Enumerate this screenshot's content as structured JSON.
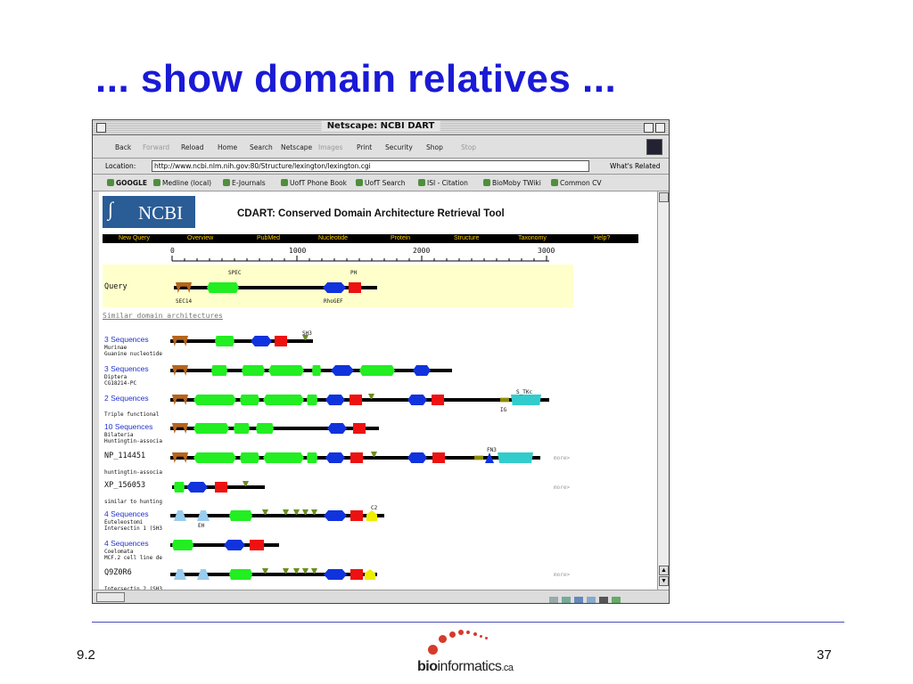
{
  "slide": {
    "title": "... show domain relatives ...",
    "left_number": "9.2",
    "right_number": "37",
    "logo_bold": "bio",
    "logo_rest": "informatics",
    "logo_suffix": ".ca"
  },
  "browser": {
    "window_title": "Netscape: NCBI DART",
    "nav_buttons": [
      "Back",
      "Forward",
      "Reload",
      "Home",
      "Search",
      "Netscape",
      "Images",
      "Print",
      "Security",
      "Shop",
      "Stop"
    ],
    "location_label": "Location:",
    "url": "http://www.ncbi.nlm.nih.gov:80/Structure/lexington/lexington.cgi",
    "whats_related": "What's Related",
    "bookmarks": [
      "GOOGLE",
      "Medline (local)",
      "E-Journals",
      "UofT Phone Book",
      "UofT Search",
      "ISI - Citation",
      "BioMoby TWiki",
      "Common CV"
    ]
  },
  "page": {
    "ncbi": "NCBI",
    "title": "CDART: Conserved Domain Architecture Retrieval Tool",
    "menu": [
      "New Query",
      "Overview",
      "PubMed",
      "Nucleotide",
      "Protein",
      "Structure",
      "Taxonomy",
      "Help?"
    ],
    "ruler": [
      "0",
      "1000",
      "2000",
      "3000"
    ],
    "query": {
      "label": "Query",
      "domain_labels": [
        "SPEC",
        "PH",
        "SEC14",
        "RhoGEF"
      ]
    },
    "section_title": "Similar domain architectures",
    "more_label": "more>",
    "rows": [
      {
        "name": "3 Sequences",
        "sub": "Murinae",
        "sub2": "Guanine nucleotide",
        "top_label": "SH3"
      },
      {
        "name": "3 Sequences",
        "sub": "Diptera",
        "sub2": "CG18214-PC"
      },
      {
        "name": "2 Sequences",
        "sub": "",
        "sub2": "Triple functional",
        "top_label": "S_TKc",
        "bottom_label": "IG"
      },
      {
        "name": "10 Sequences",
        "sub": "Bilateria",
        "sub2": "Huntingtin-associa"
      },
      {
        "name": "NP_114451",
        "sub": "",
        "sub2": "huntingtin-associa",
        "top_label": "FN3"
      },
      {
        "name": "XP_156053",
        "sub": "",
        "sub2": "similar to hunting"
      },
      {
        "name": "4 Sequences",
        "sub": "Euteleostomi",
        "sub2": "Intersectin 1 (SH3",
        "top_label": "C2",
        "bottom_label": "EH"
      },
      {
        "name": "4 Sequences",
        "sub": "Coelomata",
        "sub2": "MCF.2 cell line de"
      },
      {
        "name": "Q9Z0R6",
        "sub": "",
        "sub2": "Intersectin 2 (SH3"
      }
    ]
  },
  "colors": {
    "title_blue": "#1a1ad6",
    "sec14": "#b5651d",
    "spec": "#22ee22",
    "rhogef": "#1133dd",
    "ph": "#ee1111",
    "sh3": "#6b8e23",
    "ig": "#8b8b00",
    "stkc": "#33cccc",
    "eh": "#99ccee",
    "c2": "#eeee00"
  }
}
